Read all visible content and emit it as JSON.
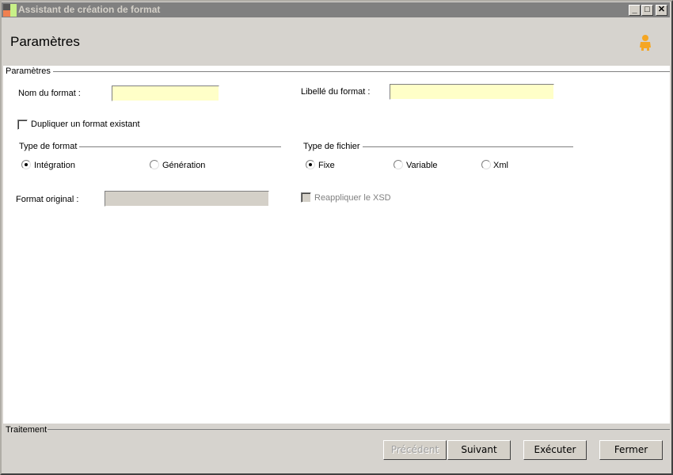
{
  "window": {
    "title": "Assistant de création de format",
    "minimize": "_",
    "maximize": "□",
    "close": "✕"
  },
  "header": {
    "title": "Paramètres",
    "user_icon": "user-icon"
  },
  "params": {
    "group_label": "Paramètres",
    "nom_label": "Nom du format :",
    "nom_value": "",
    "libelle_label": "Libellé du format :",
    "libelle_value": "",
    "dupliquer_label": "Dupliquer un format existant",
    "dupliquer_checked": false,
    "type_format": {
      "label": "Type de format",
      "options": [
        "Intégration",
        "Génération"
      ],
      "selected": "Intégration"
    },
    "type_fichier": {
      "label": "Type de fichier",
      "options": [
        "Fixe",
        "Variable",
        "Xml"
      ],
      "selected": "Fixe"
    },
    "format_original_label": "Format original :",
    "format_original_value": "",
    "reappliquer_label": "Reappliquer le XSD",
    "reappliquer_checked": false
  },
  "footer": {
    "group_label": "Traitement",
    "buttons": {
      "precedent": "Précédent",
      "suivant": "Suivant",
      "executer": "Exécuter",
      "fermer": "Fermer"
    }
  }
}
